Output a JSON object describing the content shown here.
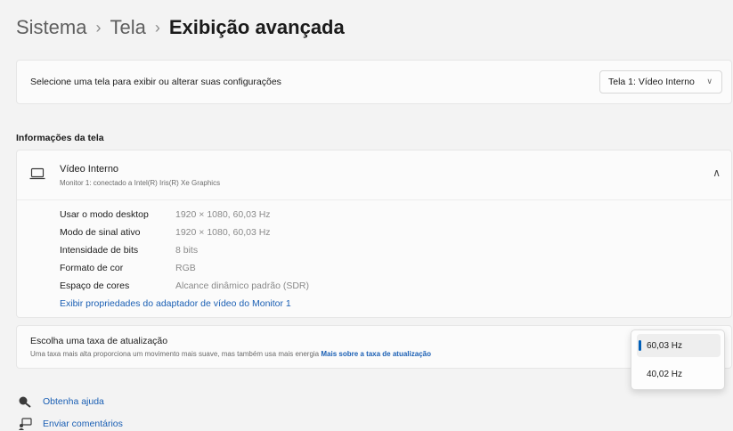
{
  "breadcrumb": {
    "crumb1": "Sistema",
    "crumb2": "Tela",
    "current": "Exibição avançada",
    "separator": "›"
  },
  "display_select": {
    "label": "Selecione uma tela para exibir ou alterar suas configurações",
    "value": "Tela 1: Vídeo Interno"
  },
  "section_title": "Informações da tela",
  "monitor": {
    "name": "Vídeo Interno",
    "subtitle": "Monitor 1: conectado a Intel(R) Iris(R) Xe Graphics",
    "rows": [
      {
        "key": "Usar o modo desktop",
        "value": "1920 × 1080, 60,03 Hz"
      },
      {
        "key": "Modo de sinal ativo",
        "value": "1920 × 1080, 60,03 Hz"
      },
      {
        "key": "Intensidade de bits",
        "value": "8 bits"
      },
      {
        "key": "Formato de cor",
        "value": "RGB"
      },
      {
        "key": "Espaço de cores",
        "value": "Alcance dinâmico padrão (SDR)"
      }
    ],
    "adapter_link": "Exibir propriedades do adaptador de vídeo do Monitor 1"
  },
  "refresh": {
    "title": "Escolha uma taxa de atualização",
    "description": "Uma taxa mais alta proporciona um movimento mais suave, mas também usa mais energia",
    "link": "Mais sobre a taxa de atualização",
    "options": [
      "60,03 Hz",
      "40,02 Hz"
    ],
    "selected": "60,03 Hz"
  },
  "footer": {
    "help": "Obtenha ajuda",
    "feedback": "Enviar comentários"
  },
  "colors": {
    "accent": "#005fb8",
    "link": "#1a5fb4",
    "background": "#f3f3f3",
    "card": "#fbfbfb"
  },
  "icons": [
    "laptop-icon",
    "chevron-down-icon",
    "chevron-up-icon",
    "help-icon",
    "feedback-icon"
  ]
}
